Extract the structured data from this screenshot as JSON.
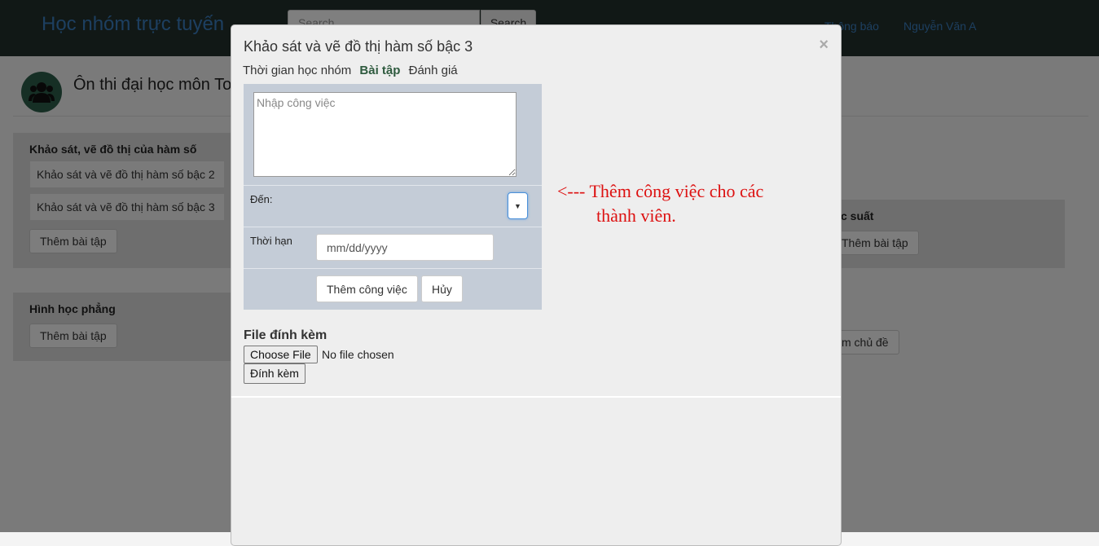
{
  "navbar": {
    "brand": "Học nhóm trực tuyến",
    "search_placeholder": "Search",
    "search_button": "Search",
    "notifications": "Thông báo",
    "user": "Nguyễn Văn A"
  },
  "group": {
    "title": "Ôn thi đại học môn Toán"
  },
  "topics": [
    {
      "title": "Khảo sát, vẽ đồ thị của hàm số",
      "items": [
        "Khảo sát và vẽ đồ thị hàm số bậc 2",
        "Khảo sát và vẽ đồ thị hàm số bậc 3"
      ],
      "add_button": "Thêm bài tập"
    },
    {
      "title": "Hình học phẳng",
      "items": [],
      "add_button": "Thêm bài tập"
    }
  ],
  "right_panel": {
    "title_fragment": "c suất",
    "add_button": "Thêm bài tập",
    "add_topic_fragment": "m chủ đề"
  },
  "modal": {
    "title": "Khảo sát và vẽ đồ thị hàm số bậc 3",
    "close": "×",
    "tabs": [
      {
        "label": "Thời gian học nhóm",
        "active": false
      },
      {
        "label": "Bài tập",
        "active": true
      },
      {
        "label": "Đánh giá",
        "active": false
      }
    ],
    "task_form": {
      "task_placeholder": "Nhập công việc",
      "to_label": "Đến:",
      "select_arrow": "▼",
      "deadline_label": "Thời hạn",
      "date_placeholder": "mm/dd/yyyy",
      "add_task_button": "Thêm công việc",
      "cancel_button": "Hủy"
    },
    "annotation": {
      "line1": "<--- Thêm công việc cho các",
      "line2": "thành viên."
    },
    "attachment": {
      "label": "File đính kèm",
      "choose_file": "Choose File",
      "file_status": "No file chosen",
      "attach_button": "Đính kèm"
    }
  },
  "colors": {
    "navbar_bg": "#22302d",
    "brand": "#3a7fc1",
    "task_form_bg": "#c4ccd7",
    "annotation": "#dd1111",
    "active_tab": "#2e5a3e"
  }
}
